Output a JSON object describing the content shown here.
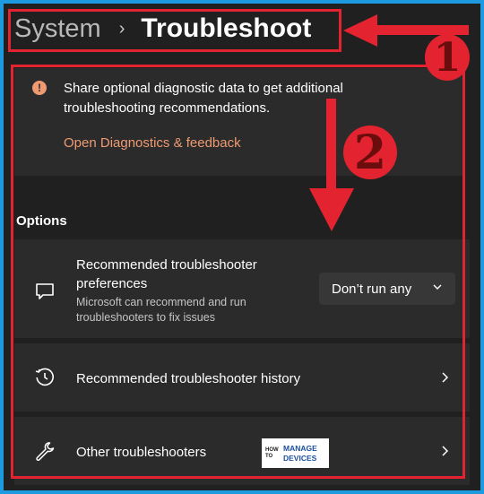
{
  "breadcrumb": {
    "parent": "System",
    "separator": "›",
    "current": "Troubleshoot"
  },
  "annotations": {
    "marker_1": "❶",
    "marker_2": "❷",
    "color": "#e3232f"
  },
  "diagnostic": {
    "icon": "info-icon",
    "text": "Share optional diagnostic data to get additional troubleshooting recommendations.",
    "link": "Open Diagnostics & feedback",
    "link_color": "#f09a72"
  },
  "options": {
    "heading": "Options",
    "rows": [
      {
        "icon": "chat-icon",
        "title_line1": "Recommended troubleshooter",
        "title_line2": "preferences",
        "subtitle_line1": "Microsoft can recommend and run",
        "subtitle_line2": "troubleshooters to fix issues",
        "dropdown_value": "Don’t run any"
      },
      {
        "icon": "history-icon",
        "title": "Recommended troubleshooter history"
      },
      {
        "icon": "wrench-icon",
        "title": "Other troubleshooters"
      }
    ]
  },
  "watermark": {
    "how": "HOW TO",
    "line1": "MANAGE",
    "line2": "DEVICES"
  },
  "colors": {
    "background": "#202020",
    "card": "#2b2b2b",
    "frame": "#1e9be0"
  }
}
